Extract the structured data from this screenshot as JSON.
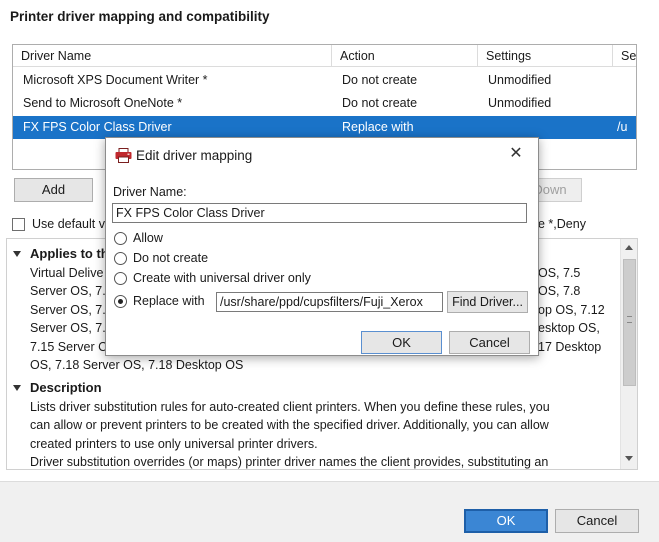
{
  "page": {
    "title": "Printer driver mapping and compatibility"
  },
  "table": {
    "columns": [
      "Driver Name",
      "Action",
      "Settings",
      "Se"
    ],
    "rows": [
      {
        "driver": "Microsoft XPS Document Writer *",
        "action": "Do not create",
        "settings": "Unmodified",
        "extra": ""
      },
      {
        "driver": "Send to Microsoft OneNote *",
        "action": "Do not create",
        "settings": "Unmodified",
        "extra": ""
      },
      {
        "driver": "FX FPS Color Class Driver",
        "action": "Replace with",
        "settings": "",
        "extra": "/u"
      }
    ],
    "selected_index": 2
  },
  "buttons": {
    "add": "Add",
    "down": "Down",
    "ok": "OK",
    "cancel": "Cancel"
  },
  "use_default": {
    "label": "Use default v",
    "trailing": "e *,Deny",
    "checked": false
  },
  "details": {
    "applies_title": "Applies to th",
    "applies_lines": [
      {
        "left": "Virtual Delive",
        "right": "OS, 7.5"
      },
      {
        "left": "Server OS, 7.",
        "right": "OS, 7.8"
      },
      {
        "left": "Server OS, 7.",
        "right": "op OS, 7.12"
      },
      {
        "left": "Server OS, 7.",
        "right": "esktop OS,"
      },
      {
        "left": "7.15 Server C",
        "right": "17 Desktop"
      },
      {
        "left": "OS, 7.18 Server OS, 7.18 Desktop OS",
        "right": ""
      }
    ],
    "description_title": "Description",
    "description_lines": [
      "Lists driver substitution rules for auto-created client printers. When you define these rules, you",
      "can allow or prevent printers to be created with the specified driver. Additionally, you can allow",
      "created printers to use only universal printer drivers.",
      "Driver substitution overrides (or maps) printer driver names the client provides, substituting an"
    ]
  },
  "dialog": {
    "title": "Edit driver mapping",
    "driver_name_label": "Driver Name:",
    "driver_name_value": "FX FPS Color Class Driver",
    "options": [
      "Allow",
      "Do not create",
      "Create with universal driver only",
      "Replace with"
    ],
    "selected_option": 3,
    "replace_path": "/usr/share/ppd/cupsfilters/Fuji_Xerox",
    "find_driver": "Find Driver...",
    "ok": "OK",
    "cancel": "Cancel"
  },
  "icons": {
    "close": "close-icon",
    "printer": "printer-icon"
  },
  "colors": {
    "selection": "#1a73c8",
    "primary_button": "#3b86d4"
  }
}
